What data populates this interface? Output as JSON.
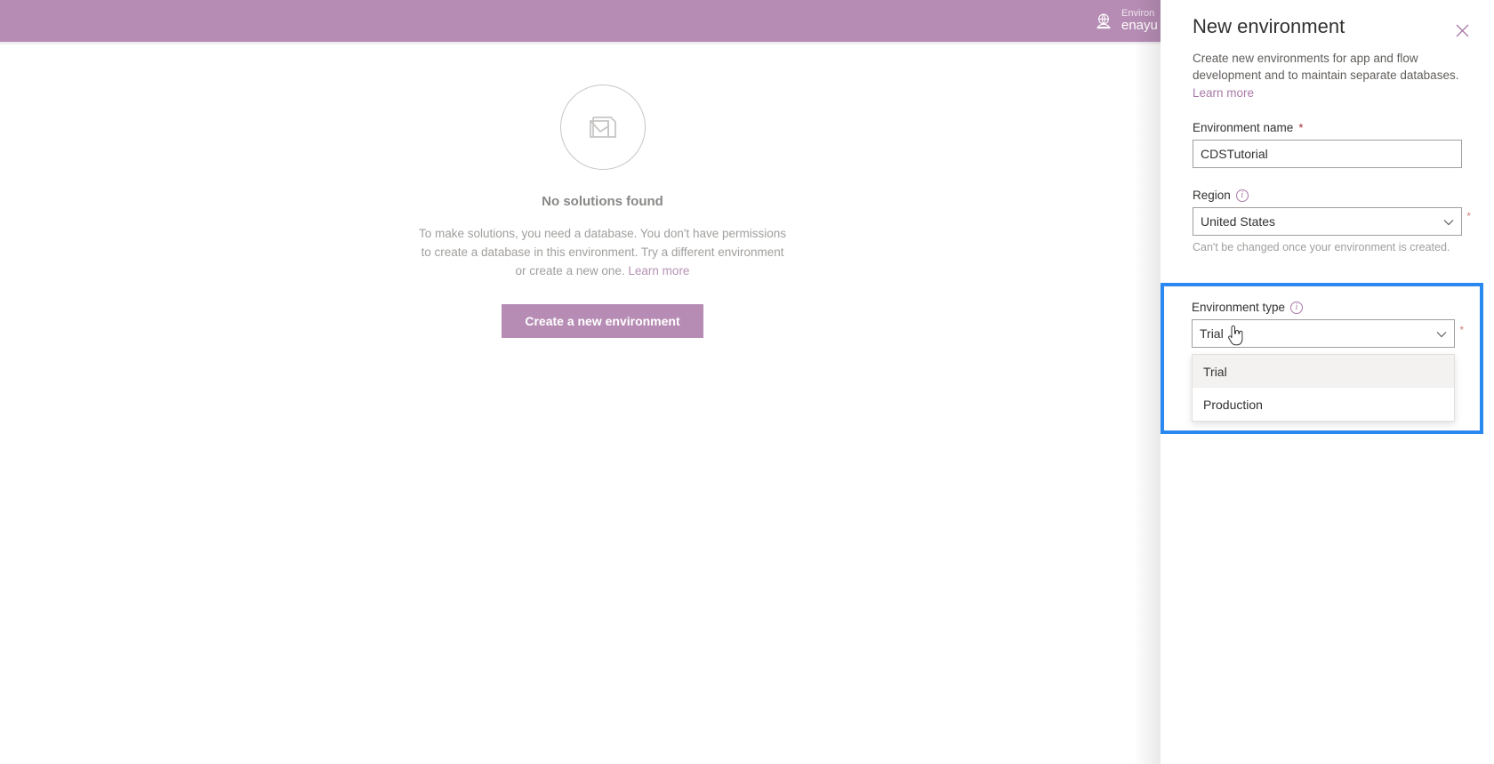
{
  "appbar": {
    "env_icon_name": "environment-globe-icon",
    "env_label": "Environ",
    "env_value": "enayu",
    "color": "#b68cb4"
  },
  "main": {
    "empty_state": {
      "icon_name": "no-solutions-illustration",
      "title": "No solutions found",
      "body_line1": "To make solutions, you need a database. You don't have permissions to",
      "body_line2": "create a database in this environment. Try a different environment or create",
      "body_line3": "a new one.",
      "learn_more": "Learn more",
      "button_label": "Create a new environment",
      "button_color": "#b68cb4"
    }
  },
  "panel": {
    "title": "New environment",
    "close_icon_name": "close-icon",
    "close_glyph": "✕",
    "description": "Create new environments for app and flow development and to maintain separate databases.",
    "description_link": "Learn more",
    "fields": {
      "environment_name": {
        "label": "Environment name",
        "required_mark": "*",
        "value": "CDSTutorial",
        "placeholder": ""
      },
      "region": {
        "label": "Region",
        "info_icon_name": "info-icon",
        "info_glyph": "i",
        "required_mark": "*",
        "value": "United States",
        "caret_glyph": "⌄",
        "hint": "Can't be changed once your environment is created."
      },
      "environment_type": {
        "label": "Environment type",
        "info_icon_name": "info-icon",
        "info_glyph": "i",
        "required_mark": "*",
        "value": "Trial",
        "caret_glyph": "⌄",
        "options": [
          {
            "label": "Trial",
            "selected": true
          },
          {
            "label": "Production",
            "selected": false
          }
        ]
      }
    },
    "focus_ring_color": "#2b88f0"
  }
}
